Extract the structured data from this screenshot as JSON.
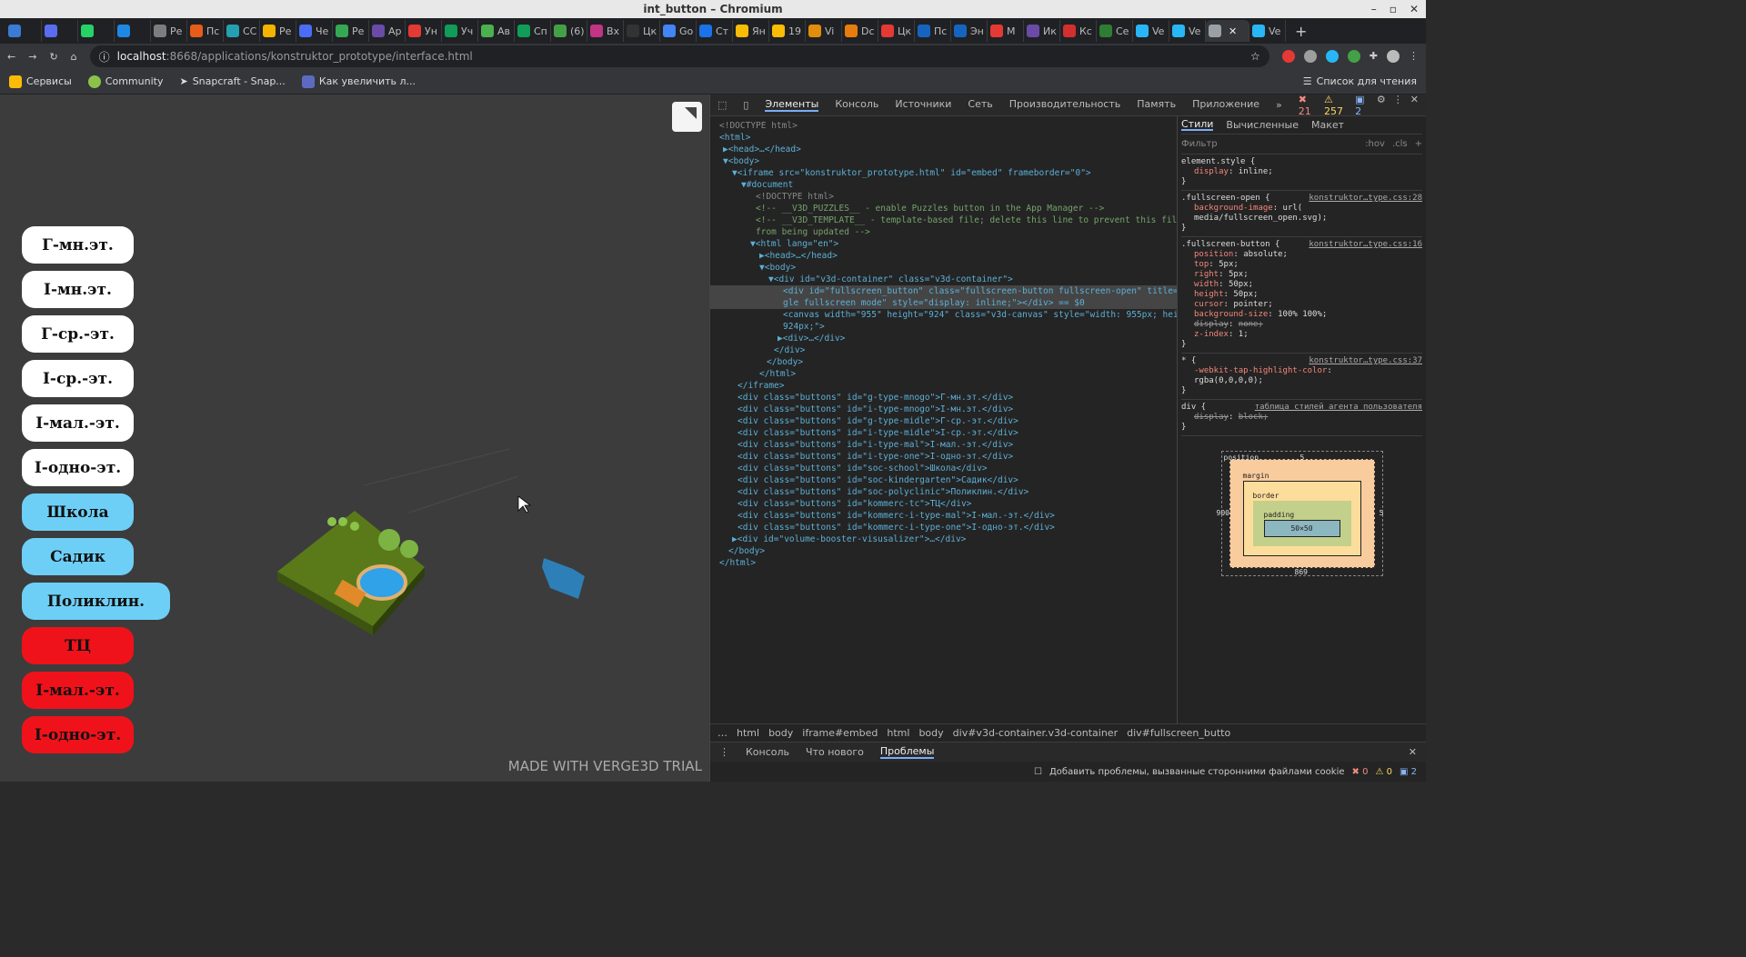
{
  "window": {
    "title": "int_button – Chromium"
  },
  "tabs": [
    {
      "label": "",
      "color": "#3a7bd5"
    },
    {
      "label": "",
      "color": "#5a6cf0"
    },
    {
      "label": "",
      "color": "#25d366"
    },
    {
      "label": "",
      "color": "#1e88e5"
    },
    {
      "label": "Ре",
      "color": "#7d7d7d"
    },
    {
      "label": "Пс",
      "color": "#e65c1a"
    },
    {
      "label": "СС",
      "color": "#25a0b0"
    },
    {
      "label": "Ре",
      "color": "#f4b400"
    },
    {
      "label": "Че",
      "color": "#4b6cf5"
    },
    {
      "label": "Ре",
      "color": "#34a853"
    },
    {
      "label": "Ар",
      "color": "#6a4ba8"
    },
    {
      "label": "Ун",
      "color": "#e53935"
    },
    {
      "label": "Уч",
      "color": "#0f9d58"
    },
    {
      "label": "Ав",
      "color": "#4caf50"
    },
    {
      "label": "Сп",
      "color": "#0f9d58"
    },
    {
      "label": "(6)",
      "color": "#43a047"
    },
    {
      "label": "Вх",
      "color": "#c13584"
    },
    {
      "label": "Цк",
      "color": "#333"
    },
    {
      "label": "Go",
      "color": "#4285f4"
    },
    {
      "label": "Ст",
      "color": "#1a73e8"
    },
    {
      "label": "Ян",
      "color": "#fbbc05"
    },
    {
      "label": "19",
      "color": "#fbbc05"
    },
    {
      "label": "Vi",
      "color": "#e08e0b"
    },
    {
      "label": "Dc",
      "color": "#e87d0d"
    },
    {
      "label": "Цк",
      "color": "#e53935"
    },
    {
      "label": "Пс",
      "color": "#1565c0"
    },
    {
      "label": "Эн",
      "color": "#1565c0"
    },
    {
      "label": "М",
      "color": "#e53935"
    },
    {
      "label": "Ик",
      "color": "#6a4ba8"
    },
    {
      "label": "Кс",
      "color": "#d32f2f"
    },
    {
      "label": "Се",
      "color": "#2e7d32"
    },
    {
      "label": "Ve",
      "color": "#29b6f6"
    },
    {
      "label": "Ve",
      "color": "#29b6f6"
    },
    {
      "label": "",
      "color": "#9aa0a6",
      "active": true
    },
    {
      "label": "Ve",
      "color": "#29b6f6"
    }
  ],
  "address": {
    "host": "localhost",
    "path": ":8668/applications/konstruktor_prototype/interface.html"
  },
  "bookmarks": {
    "items": [
      "Сервисы",
      "Community",
      "Snapcraft - Snap...",
      "Как увеличить л..."
    ],
    "reading_list": "Список для чтения"
  },
  "app": {
    "buttons": [
      {
        "label": "Г-мн.эт.",
        "style": "white"
      },
      {
        "label": "І-мн.эт.",
        "style": "white"
      },
      {
        "label": "Г-ср.-эт.",
        "style": "white"
      },
      {
        "label": "І-ср.-эт.",
        "style": "white"
      },
      {
        "label": "І-мал.-эт.",
        "style": "white"
      },
      {
        "label": "І-одно-эт.",
        "style": "white"
      },
      {
        "label": "Школа",
        "style": "blue"
      },
      {
        "label": "Садик",
        "style": "blue"
      },
      {
        "label": "Поликлин.",
        "style": "blue"
      },
      {
        "label": "ТЦ",
        "style": "red"
      },
      {
        "label": "І-мал.-эт.",
        "style": "red"
      },
      {
        "label": "І-одно-эт.",
        "style": "red"
      }
    ],
    "watermark": "MADE WITH VERGE3D TRIAL"
  },
  "devtools": {
    "tabs": [
      "Элементы",
      "Консоль",
      "Источники",
      "Сеть",
      "Производительность",
      "Память",
      "Приложение"
    ],
    "errors": "21",
    "warnings": "257",
    "infos": "2",
    "style_tabs": [
      "Стили",
      "Вычисленные",
      "Макет"
    ],
    "filter_placeholder": "Фильтр",
    "filter_hov": ":hov",
    "filter_cls": ".cls",
    "dom_lines": [
      "<!DOCTYPE html>",
      "<html>",
      "▶<head>…</head>",
      "▼<body>",
      "▼<iframe src=\"konstruktor_prototype.html\" id=\"embed\" frameborder=\"0\">",
      "▼#document",
      "<!DOCTYPE html>",
      "<!-- __V3D_PUZZLES__ - enable Puzzles button in the App Manager -->",
      "<!-- __V3D_TEMPLATE__ - template-based file; delete this line to prevent this file",
      "from being updated -->",
      "▼<html lang=\"en\">",
      "▶<head>…</head>",
      "▼<body>",
      "▼<div id=\"v3d-container\" class=\"v3d-container\">",
      "<div id=\"fullscreen_button\" class=\"fullscreen-button fullscreen-open\" title=\"Tog",
      "gle fullscreen mode\" style=\"display: inline;\"></div> == $0",
      "<canvas width=\"955\" height=\"924\" class=\"v3d-canvas\" style=\"width: 955px; height:",
      "924px;\">",
      "▶<div>…</div>",
      "</div>",
      "</body>",
      "</html>",
      "</iframe>",
      "<div class=\"buttons\" id=\"g-type-mnogo\">Г-мн.эт.</div>",
      "<div class=\"buttons\" id=\"i-type-mnogo\">І-мн.эт.</div>",
      "<div class=\"buttons\" id=\"g-type-midle\">Г-ср.-эт.</div>",
      "<div class=\"buttons\" id=\"i-type-midle\">І-ср.-эт.</div>",
      "<div class=\"buttons\" id=\"i-type-mal\">І-мал.-эт.</div>",
      "<div class=\"buttons\" id=\"i-type-one\">І-одно-эт.</div>",
      "<div class=\"buttons\" id=\"soc-school\">Школа</div>",
      "<div class=\"buttons\" id=\"soc-kindergarten\">Садик</div>",
      "<div class=\"buttons\" id=\"soc-polyclinic\">Поликлин.</div>",
      "<div class=\"buttons\" id=\"kommerc-tc\">ТЦ</div>",
      "<div class=\"buttons\" id=\"kommerc-i-type-mal\">І-мал.-эт.</div>",
      "<div class=\"buttons\" id=\"kommerc-i-type-one\">І-одно-эт.</div>",
      "▶<div id=\"volume-booster-visusalizer\">…</div>",
      "</body>",
      "</html>"
    ],
    "rules": [
      {
        "selector": "element.style {",
        "source": "",
        "props": [
          [
            "display",
            "inline;"
          ]
        ]
      },
      {
        "selector": ".fullscreen-open {",
        "source": "konstruktor…type.css:28",
        "props": [
          [
            "background-image",
            "url("
          ],
          [
            "",
            "media/fullscreen_open.svg);"
          ]
        ]
      },
      {
        "selector": ".fullscreen-button {",
        "source": "konstruktor…type.css:16",
        "props": [
          [
            "position",
            "absolute;"
          ],
          [
            "top",
            "5px;"
          ],
          [
            "right",
            "5px;"
          ],
          [
            "width",
            "50px;"
          ],
          [
            "height",
            "50px;"
          ],
          [
            "cursor",
            "pointer;"
          ],
          [
            "background-size",
            "100% 100%;"
          ],
          [
            "display",
            "none;"
          ],
          [
            "z-index",
            "1;"
          ]
        ]
      },
      {
        "selector": "* {",
        "source": "konstruktor…type.css:37",
        "props": [
          [
            "-webkit-tap-highlight-color",
            ""
          ],
          [
            "",
            "rgba(0,0,0,0);"
          ]
        ]
      },
      {
        "selector": "div {",
        "source": "таблица стилей агента пользователя",
        "props": [
          [
            "display",
            "block;"
          ]
        ]
      }
    ],
    "boxmodel": {
      "position": "position",
      "pos_top": "5",
      "pos_left": "900",
      "pos_right": "5",
      "pos_bottom": "869",
      "margin": "margin",
      "border": "border",
      "padding": "padding",
      "content": "50×50",
      "dash": "–"
    },
    "breadcrumbs": [
      "html",
      "body",
      "iframe#embed",
      "html",
      "body",
      "div#v3d-container.v3d-container",
      "div#fullscreen_butto"
    ],
    "drawer_tabs": [
      "Консоль",
      "Что нового",
      "Проблемы"
    ],
    "drawer_checkbox": "Добавить проблемы, вызванные сторонними файлами cookie",
    "drawer_counts": [
      "0",
      "0",
      "2"
    ]
  }
}
